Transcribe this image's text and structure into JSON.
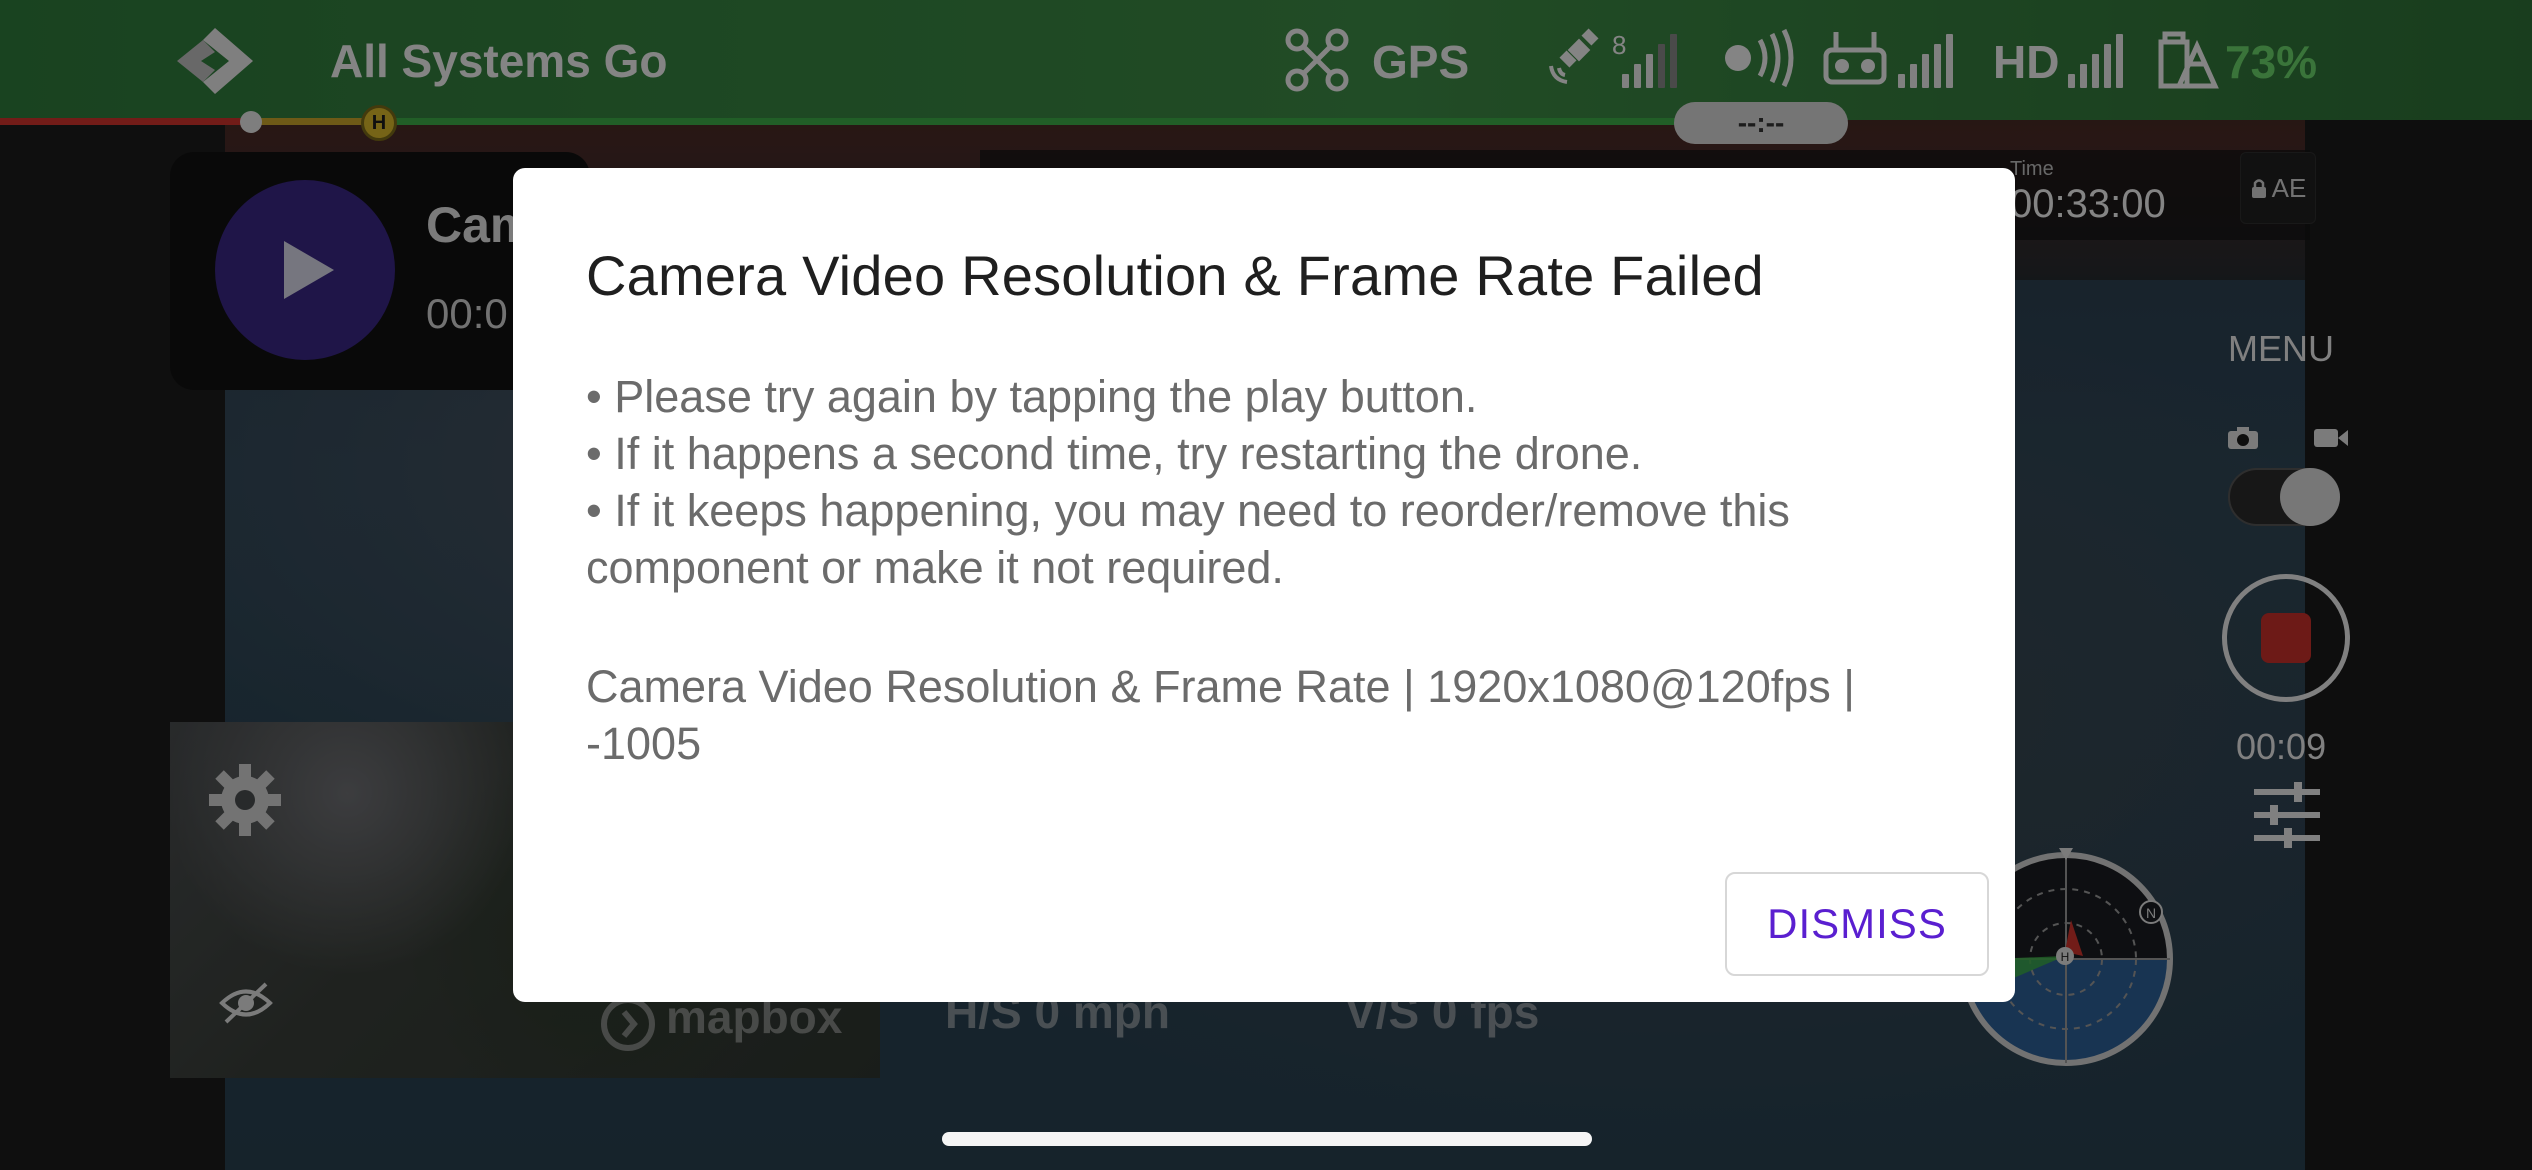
{
  "status": {
    "text": "All Systems Go",
    "gps_label": "GPS",
    "satellite_count": "8",
    "hd_label": "HD",
    "battery_percent": "73%",
    "battery_color": "#6bd36a"
  },
  "progress": {
    "home_marker_label": "H",
    "time_remaining": "--:--"
  },
  "camera_params": {
    "time_label": "Time",
    "time_value": "00:33:00",
    "ae_label": "AE"
  },
  "mission_card": {
    "title": "Cam",
    "time": "00:0"
  },
  "right_rail": {
    "menu_label": "MENU",
    "record_time": "00:09"
  },
  "map": {
    "attribution": "mapbox"
  },
  "telemetry": {
    "horizontal_speed": "H/S  0 mph",
    "vertical_speed": "V/S  0 fps"
  },
  "dialog": {
    "title": "Camera Video Resolution & Frame Rate Failed",
    "bullets": [
      "• Please try again by tapping the play button.",
      "• If it happens a second time, try restarting the drone.",
      "• If it keeps happening, you may need to reorder/remove this component or make it not required."
    ],
    "detail": "Camera Video Resolution & Frame Rate | 1920x1080@120fps | -1005",
    "dismiss_label": "DISMISS"
  },
  "colors": {
    "accent": "#5a1fd0",
    "status_bar_green": "#3d8a45",
    "record_red": "#c6302a",
    "play_button_purple": "#3a2784"
  }
}
